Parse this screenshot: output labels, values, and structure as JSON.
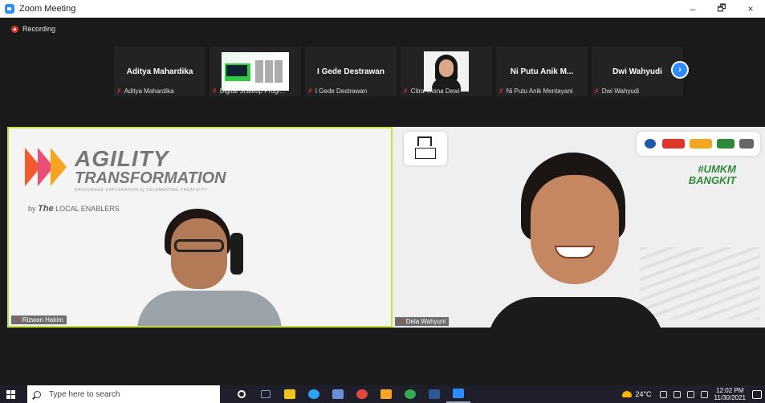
{
  "window": {
    "title": "Zoom Meeting",
    "minimize": "–",
    "restore": "🗗",
    "close": "×"
  },
  "recording": {
    "label": "Recording"
  },
  "participants": [
    {
      "name": "Aditya Mahardika",
      "caption": "Aditya Mahardika",
      "type": "name"
    },
    {
      "name": "",
      "caption": "Digital Scaleup Progr...",
      "type": "slide"
    },
    {
      "name": "I Gede Destrawan",
      "caption": "I Gede Destrawan",
      "type": "name"
    },
    {
      "name": "",
      "caption": "Citra Trisna Dewi",
      "type": "photo"
    },
    {
      "name": "Ni Putu Anik M...",
      "caption": "Ni Putu Anik Mentayani",
      "type": "name"
    },
    {
      "name": "Dwi Wahyudi",
      "caption": "Dwi Wahyudi",
      "type": "name"
    }
  ],
  "next_label": "›",
  "main_videos": {
    "left": {
      "caption": "Rizwan Hakim",
      "logo_title": "AGILITY",
      "logo_sub": "TRANSFORMATION",
      "logo_tag": "ENCOURAGE EXPLORATION by CELEBRATING CREATIVITY",
      "by_prefix": "by",
      "by_brand": "The",
      "by_suffix": "LOCAL ENABLERS"
    },
    "right": {
      "caption": "Dela Wahyuni",
      "hashtag_1": "#UMKM",
      "hashtag_2": "BANGKIT"
    }
  },
  "taskbar": {
    "search_placeholder": "Type here to search",
    "weather": "24°C",
    "time": "12:02 PM",
    "date": "11/30/2021",
    "app_colors": [
      "#ffffff",
      "#8aa0c8",
      "#f0c419",
      "#2ea3f2",
      "#6b8fd8",
      "#e04a3f",
      "#f5a623",
      "#34a853",
      "#2b579a",
      "#2d8cff"
    ]
  }
}
